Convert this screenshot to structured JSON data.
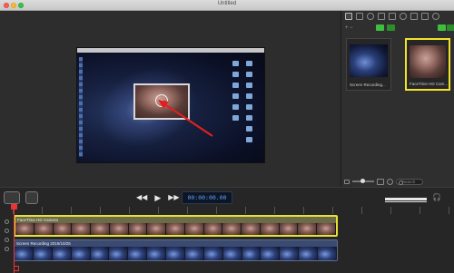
{
  "window": {
    "title": "Untitled"
  },
  "canvas": {
    "webcam_overlay": "FaceTime HD Camera"
  },
  "media_panel": {
    "items": [
      {
        "label": "Screen Recording...",
        "kind": "screen",
        "selected": false
      },
      {
        "label": "FaceTime HD Cam...",
        "kind": "camera",
        "selected": true
      }
    ],
    "search_placeholder": "Search"
  },
  "controls": {
    "timecode": "00:00:00.00",
    "play_icon": "play-icon",
    "rewind_icon": "rewind-icon",
    "forward_icon": "fast-forward-icon"
  },
  "timeline": {
    "tracks": [
      {
        "label": "FaceTime HD Camera",
        "selected": true
      },
      {
        "label": "Screen Recording 2019/10/25",
        "selected": false
      }
    ]
  },
  "colors": {
    "selection": "#f3e32a",
    "timecode_text": "#5aa0ff",
    "playhead": "#e33333",
    "accent_green": "#3fbf3f"
  }
}
